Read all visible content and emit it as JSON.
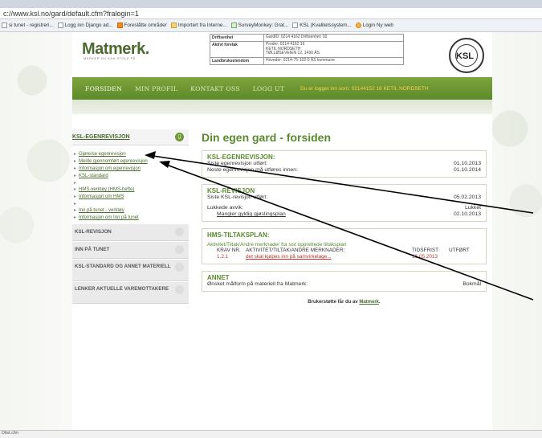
{
  "browser": {
    "url": "c://www.ksl.no/gard/default.cfm?fralogin=1",
    "bookmarks": [
      {
        "label": "si tunet - registreri...",
        "icon": "page-icon"
      },
      {
        "label": "Logg inn Django ad...",
        "icon": "page-icon"
      },
      {
        "label": "Foreslåtte områder",
        "icon": "orange-square-icon"
      },
      {
        "label": "Importert fra Interne...",
        "icon": "folder-icon"
      },
      {
        "label": "SurveyMonkey: Grat...",
        "icon": "survey-icon"
      },
      {
        "label": "KSL (Kvalitetssystem...",
        "icon": "page-icon"
      },
      {
        "label": "Login Ny web",
        "icon": "orange-circle-icon"
      }
    ],
    "status": "Dlist.cfm"
  },
  "header": {
    "logo": "Matmerk.",
    "logo_sub": "MERKER DU KAN STOLE PÅ",
    "info_rows": [
      {
        "key": "Driftsenhet",
        "value": "GardID: 0214 4162 Driftsenhet: 02"
      },
      {
        "key": "Aktivt foretak",
        "value": "Prodnr: 0214 4162 16\nKETIL NORDSETH\nTØLLØSEVEIEN 12, 1430 ÅS"
      },
      {
        "key": "Landbrukseiendom",
        "value": "Hovednr: 0214-75-102-0   ÅS kommune"
      }
    ],
    "seal_text": "KSL",
    "seal_ring": "KVALITETSSYSTEM I LANDBRUKET"
  },
  "nav": {
    "items": [
      "FORSIDEN",
      "MIN PROFIL",
      "KONTAKT OSS",
      "LOGG UT"
    ],
    "status": "Du er logget inn som: 02144152 16 KETIL NORDSETH"
  },
  "sidebar": {
    "sections": [
      {
        "title": "KSL-EGENREVISJON",
        "links": [
          "Gjøre/se egenrevisjon",
          "Melde gjennomført egenrevisjon",
          "Informasjon om egenrevisjon",
          "KSL-standard",
          "HMS-verktøy (HMS-hefte)",
          "Informasjon om HMS",
          "Inn på tunet - verktøy",
          "Informasjon om Inn på tunet"
        ]
      }
    ],
    "collapsed": [
      "KSL-REVISJON",
      "INN PÅ TUNET",
      "KSL-STANDARD OG ANNET MATERIELL",
      "LENKER AKTUELLE VAREMOTTAKERE"
    ]
  },
  "main": {
    "title": "Din egen gard - forsiden",
    "egen": {
      "title": "KSL-EGENREVISJON:",
      "row1_label": "Siste egenrevisjon utført:",
      "row1_value": "01.10.2013",
      "row2_label": "Neste egenrevisjon må utføres innen:",
      "row2_value": "01.10.2014"
    },
    "rev": {
      "title": "KSL-REVISJON",
      "row1_label": "Siste KSL-revisjon utført:",
      "row1_value": "05.02.2013",
      "row2_label": "Lukkede avvik:",
      "row2_value": "Lukket",
      "row3_label": "Mangler gyldig gjøslingsplan",
      "row3_value": "02.10.2013"
    },
    "hms": {
      "title": "HMS-TILTAKSPLAN:",
      "sub": "Aktivitet/Tiltak/Andre merknader fra sist opprettede tiltaksplan",
      "headers": [
        "KRAV NR.",
        "AKTIVITET/TILTAK/ANDRE MERKNADER:",
        "TIDSFRIST",
        "UTFØRT"
      ],
      "row": [
        "1.2.1",
        "det skal kjøpes inn på samvirkelage...",
        "16.05.2013",
        ""
      ]
    },
    "annet": {
      "title": "ANNET",
      "label": "Ønsket målform på materiell fra Matmerk:",
      "value": "Bokmål"
    },
    "footer_prefix": "Brukerstøtte får du av ",
    "footer_link": "Matmerk",
    "footer_suffix": "."
  }
}
